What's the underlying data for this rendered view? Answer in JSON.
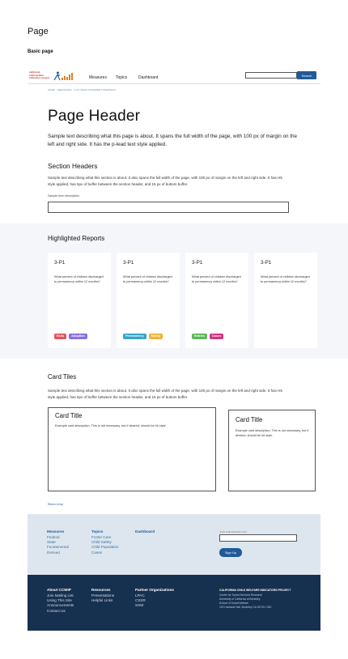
{
  "doc": {
    "title": "Page",
    "subtitle": "Basic page"
  },
  "logo": {
    "line1": "california",
    "line2": "child welfare",
    "line3": "indicators project"
  },
  "nav": {
    "items": [
      "Measures",
      "Topics",
      "Dashboard"
    ]
  },
  "search": {
    "button": "Search",
    "placeholder": ""
  },
  "breadcrumb": [
    "HOME",
    "MEASURES",
    "3-P1 PAGE STATEMENT SNAPSHOT"
  ],
  "main": {
    "page_header": "Page Header",
    "lead": "Sample text describing what this page is about.  It spans the full width of the page, with 100 px of margin on the left and right side. It has the p-lead text style applied.",
    "section_header": "Section Headers",
    "section_text": "Sample text describing what this section is about. It also spans the full width of the page, with 100 px of margin on the left and right side. It has H5 style applied, has 5px of buffer between the section header, and 15 px of buttom buffer.",
    "form_label": "Sample form description"
  },
  "highlighted": {
    "title": "Highlighted Reports",
    "cards": [
      {
        "id": "3-P1",
        "question": "What percent of children discharged to permanency within 12 months?",
        "tags": [
          {
            "label": "Exits",
            "color": "#e0555a"
          },
          {
            "label": "Adoption",
            "color": "#8a6fe0"
          }
        ]
      },
      {
        "id": "3-P1",
        "question": "What percent of children discharged to permanency within 12 months?",
        "tags": [
          {
            "label": "Permanency",
            "color": "#36a6c8"
          },
          {
            "label": "Safety",
            "color": "#f2b233"
          }
        ]
      },
      {
        "id": "3-P1",
        "question": "What percent of children discharged to permanency within 12 months?",
        "tags": [
          {
            "label": "Entries",
            "color": "#5cb85c"
          },
          {
            "label": "Cases",
            "color": "#d63384"
          }
        ]
      },
      {
        "id": "3-P1",
        "question": "What percent of children discharged to permanency within 12 months?",
        "tags": []
      }
    ]
  },
  "tiles": {
    "title": "Card Tiles",
    "text": "Sample text describing what this section is about. It also spans the full width of the page, with 100 px of margin on the left and right side. It has H5 style applied, has 5px of buffer between the section header, and 15 px of buttom buffer.",
    "card1": {
      "title": "Card Title",
      "desc": "Example card description. This is not necessary, but if desired, should be h6 style."
    },
    "card2": {
      "title": "Card Title",
      "desc": "Example card description. This is not necessary, but if desired, should be h6 style."
    }
  },
  "return_top": "Return to top",
  "footer": {
    "measures": {
      "heading": "Measures",
      "links": [
        "Federal",
        "State",
        "Fundamental",
        "Derived"
      ]
    },
    "topics": {
      "heading": "Topics",
      "links": [
        "Foster Care",
        "Child Safety",
        "Child Population",
        "Cases"
      ]
    },
    "dashboard": {
      "heading": "Dashboard"
    },
    "mailing": {
      "label": "JOIN THE MAILING LIST",
      "button": "Sign Up"
    },
    "about": {
      "heading": "About CCWIP",
      "links": [
        "Join Mailing List",
        "Using This Site",
        "Announcements",
        "Contact Us"
      ]
    },
    "resources": {
      "heading": "Resources",
      "links": [
        "Presentations",
        "Helpful Links"
      ]
    },
    "partners": {
      "heading": "Partner Organizations",
      "links": [
        "LPAC",
        "CSSR",
        "SSW"
      ]
    },
    "project": {
      "heading": "CALIFORNIA CHILD WELFARE INDICATORS PROJECT",
      "lines": [
        "Center for Social Services Research",
        "University of California at Berkeley",
        "School of Social Welfare",
        "120 Haviland Hall, Berkeley CA 94720-7400"
      ]
    }
  }
}
